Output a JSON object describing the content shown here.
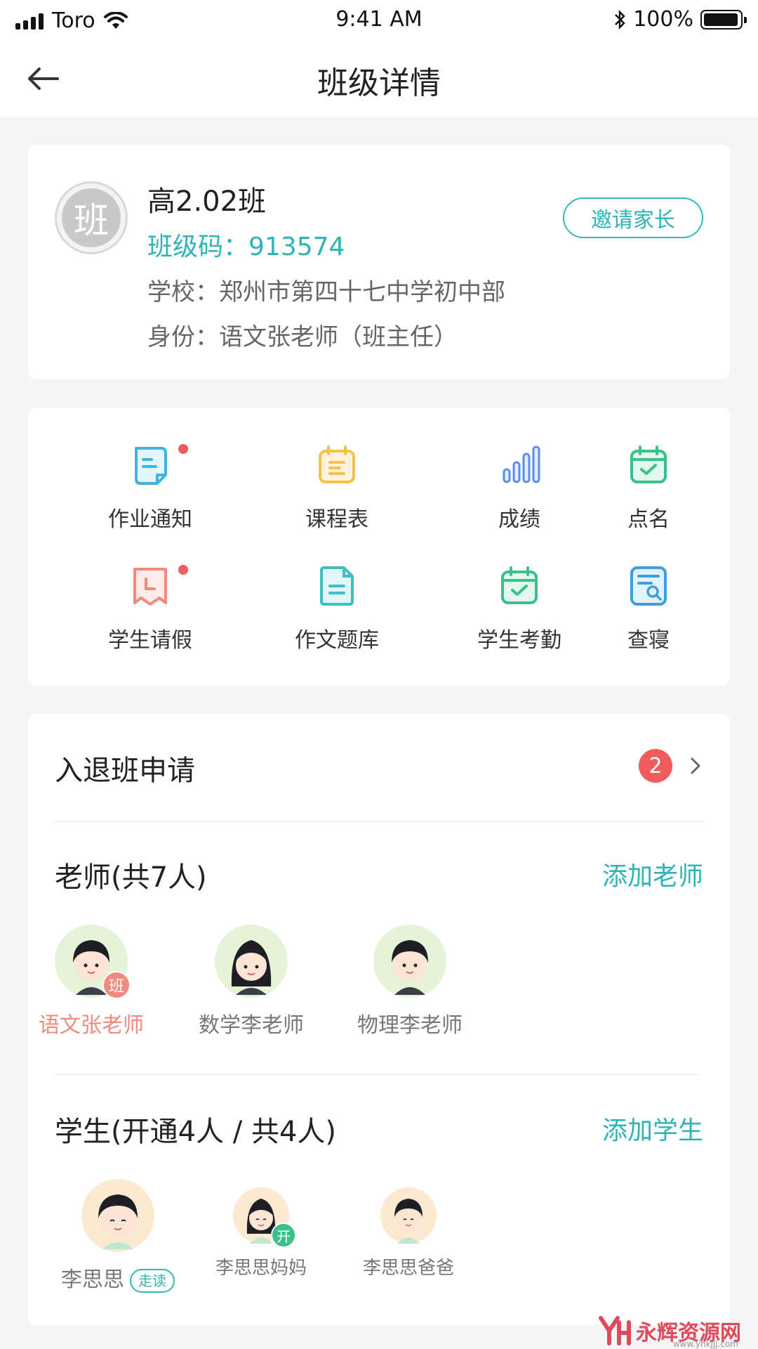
{
  "status_bar": {
    "carrier": "Toro",
    "time": "9:41 AM",
    "battery": "100%"
  },
  "nav": {
    "title": "班级详情"
  },
  "class_info": {
    "logo_char": "班",
    "name": "高2.02班",
    "code": "班级码：913574",
    "school": "学校：郑州市第四十七中学初中部",
    "role": "身份：语文张老师（班主任）",
    "invite_label": "邀请家长"
  },
  "features": [
    {
      "label": "作业通知",
      "icon": "homework-notice-icon",
      "color": "#3fb4e0",
      "has_dot": true
    },
    {
      "label": "课程表",
      "icon": "schedule-icon",
      "color": "#f5c14b",
      "has_dot": false
    },
    {
      "label": "成绩",
      "icon": "grades-bar-icon",
      "color": "#5b8fe0",
      "has_dot": false
    },
    {
      "label": "点名",
      "icon": "roll-call-icon",
      "color": "#3cc08a",
      "has_dot": false
    },
    {
      "label": "学生请假",
      "icon": "leave-request-icon",
      "color": "#f08a7e",
      "has_dot": true
    },
    {
      "label": "作文题库",
      "icon": "essay-bank-icon",
      "color": "#3fc0c0",
      "has_dot": false
    },
    {
      "label": "学生考勤",
      "icon": "attendance-icon",
      "color": "#3cc08a",
      "has_dot": false
    },
    {
      "label": "查寝",
      "icon": "dorm-check-icon",
      "color": "#3f9ee0",
      "has_dot": false
    }
  ],
  "apply": {
    "title": "入退班申请",
    "count": "2"
  },
  "teachers": {
    "title": "老师(共7人)",
    "add_label": "添加老师",
    "items": [
      {
        "name": "语文张老师",
        "tag": "班",
        "highlight": true
      },
      {
        "name": "数学李老师"
      },
      {
        "name": "物理李老师"
      }
    ]
  },
  "students": {
    "title": "学生(开通4人 / 共4人)",
    "add_label": "添加学生",
    "items": [
      {
        "name": "李思思",
        "badge": "走读"
      },
      {
        "name": "李思思妈妈",
        "tag": "开"
      },
      {
        "name": "李思思爸爸"
      }
    ]
  },
  "watermark": {
    "text": "永辉资源网",
    "sub": "www.yhkjjj.com"
  },
  "colors": {
    "accent": "#2fb4b6",
    "alert": "#f25b5b",
    "highlight_name": "#f08a7e"
  }
}
